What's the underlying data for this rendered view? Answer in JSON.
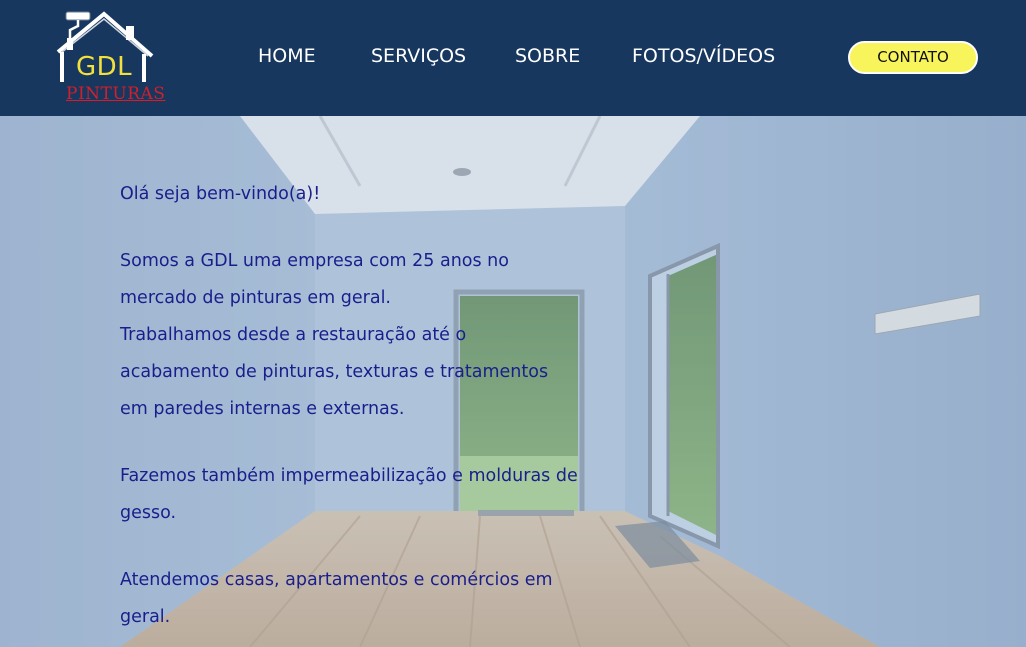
{
  "header": {
    "logo": {
      "brand": "GDL",
      "sub": "PINTURAS"
    },
    "nav": [
      "HOME",
      "SERVIÇOS",
      "SOBRE",
      "FOTOS/VÍDEOS"
    ],
    "contact_label": "CONTATO"
  },
  "colors": {
    "header_bg": "#17375f",
    "contact_bg": "#f7f45c",
    "text_color": "#1a1e8c",
    "logo_brand": "#f2e13c",
    "logo_sub": "#d31f2b"
  },
  "main": {
    "greeting": "Olá seja bem-vindo(a)!",
    "paragraphs": [
      "Somos a GDL uma empresa com 25 anos no mercado de pinturas em geral.",
      "Trabalhamos desde a restauração até o acabamento de pinturas, texturas e tratamentos em paredes internas e externas.",
      "Fazemos também impermeabilização e molduras de gesso.",
      "Atendemos casas, apartamentos e comércios em geral."
    ]
  }
}
